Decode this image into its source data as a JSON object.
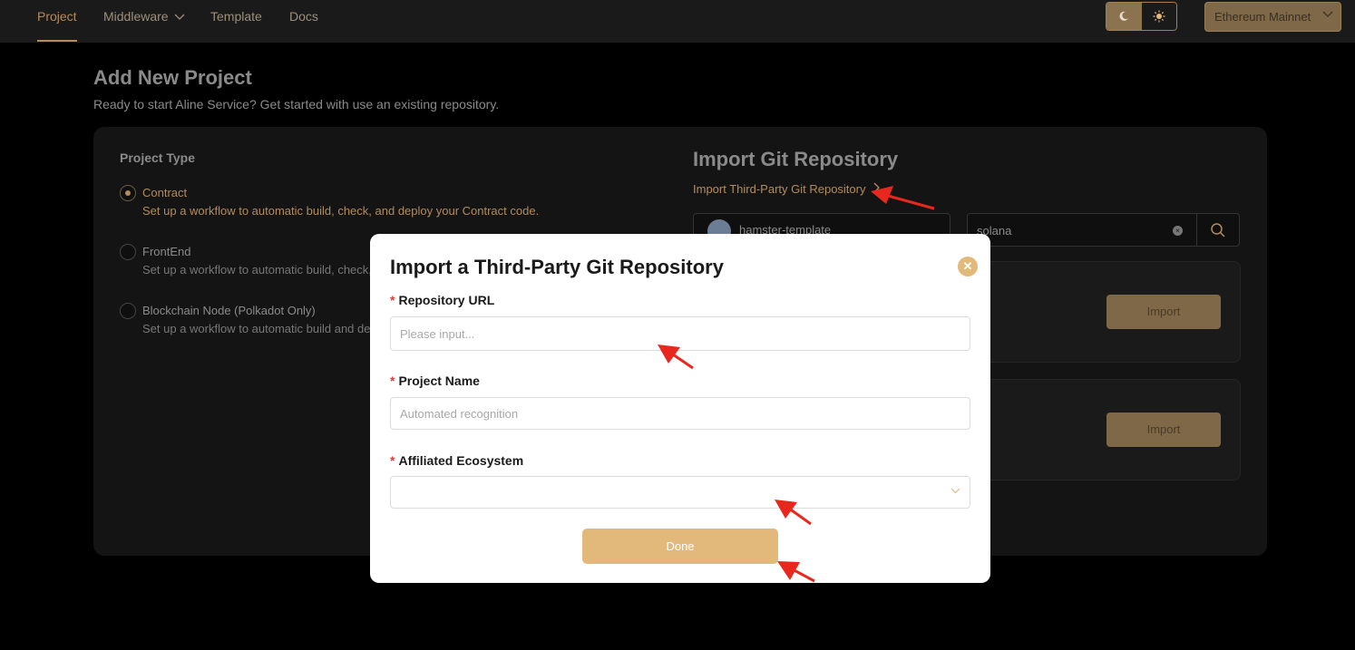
{
  "nav": {
    "items": [
      "Project",
      "Middleware",
      "Template",
      "Docs"
    ],
    "network": "Ethereum Mainnet"
  },
  "page": {
    "title": "Add New Project",
    "subtitle": "Ready to start Aline Service? Get started with use an existing repository."
  },
  "project_type": {
    "title": "Project Type",
    "options": [
      {
        "label": "Contract",
        "desc": "Set up a workflow to automatic build, check, and deploy your Contract code.",
        "checked": true
      },
      {
        "label": "FrontEnd",
        "desc": "Set up a workflow to automatic build, check, a",
        "checked": false
      },
      {
        "label": "Blockchain Node (Polkadot Only)",
        "desc": "Set up a workflow to automatic build and dep",
        "checked": false
      }
    ]
  },
  "import": {
    "title": "Import Git Repository",
    "link": "Import Third-Party Git Repository",
    "repo_owner": "hamster-template",
    "search_value": "solana",
    "buttons": [
      "Import",
      "Import"
    ]
  },
  "modal": {
    "title": "Import a Third-Party Git Repository",
    "fields": [
      {
        "label": "Repository URL",
        "placeholder": "Please input..."
      },
      {
        "label": "Project Name",
        "placeholder": "Automated recognition"
      },
      {
        "label": "Affiliated Ecosystem",
        "placeholder": ""
      }
    ],
    "done_label": "Done"
  },
  "colors": {
    "accent": "#b38b5c",
    "modal_button": "#e3b97b",
    "required": "#e03a3a",
    "annotation_arrow": "#e8281e"
  }
}
